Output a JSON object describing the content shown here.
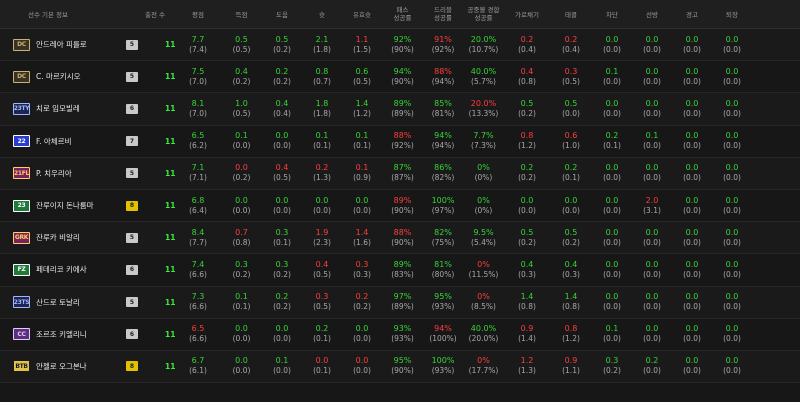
{
  "header": {
    "player_info": "선수 기본 정보",
    "apps": "출전 수",
    "rating": "평점",
    "goals": "득점",
    "assists": "도움",
    "shots": "슛",
    "on_target": "유효슛",
    "pass_success": "패스\n성공률",
    "dribble_success": "드리블\n성공률",
    "aerial_success": "공중볼 경합\n성공률",
    "interceptions": "가로채기",
    "tackles": "태클",
    "blocks": "차단",
    "saves": "선방",
    "yellow": "경고",
    "red": "퇴장"
  },
  "players": [
    {
      "pos": "DC",
      "pos_color": "#c8b27a",
      "pos_bg": "#3b3322",
      "name": "안드레아 피를로",
      "level": "5",
      "gold": false,
      "apps": "11",
      "stats": [
        [
          "7.7",
          "(7.4)",
          "g"
        ],
        [
          "0.5",
          "(0.5)",
          "g"
        ],
        [
          "0.5",
          "(0.2)",
          "g"
        ],
        [
          "2.1",
          "(1.8)",
          "g"
        ],
        [
          "1.1",
          "(1.5)",
          "r"
        ],
        [
          "92%",
          "(90%)",
          "g"
        ],
        [
          "91%",
          "(92%)",
          "r"
        ],
        [
          "20.0%",
          "(10.7%)",
          "g"
        ],
        [
          "0.2",
          "(0.4)",
          "r"
        ],
        [
          "0.2",
          "(0.4)",
          "r"
        ],
        [
          "0.0",
          "(0.0)",
          "g"
        ],
        [
          "0.0",
          "(0.0)",
          "g"
        ],
        [
          "0.0",
          "(0.0)",
          "g"
        ],
        [
          "0.0",
          "(0.0)",
          "g"
        ]
      ]
    },
    {
      "pos": "DC",
      "pos_color": "#c8b27a",
      "pos_bg": "#3b3322",
      "name": "C. 마르키시오",
      "level": "5",
      "gold": false,
      "apps": "11",
      "stats": [
        [
          "7.5",
          "(7.0)",
          "g"
        ],
        [
          "0.4",
          "(0.2)",
          "g"
        ],
        [
          "0.2",
          "(0.2)",
          "g"
        ],
        [
          "0.8",
          "(0.7)",
          "g"
        ],
        [
          "0.6",
          "(0.5)",
          "g"
        ],
        [
          "94%",
          "(90%)",
          "g"
        ],
        [
          "88%",
          "(94%)",
          "r"
        ],
        [
          "40.0%",
          "(5.7%)",
          "g"
        ],
        [
          "0.4",
          "(0.8)",
          "r"
        ],
        [
          "0.3",
          "(0.5)",
          "r"
        ],
        [
          "0.1",
          "(0.0)",
          "g"
        ],
        [
          "0.0",
          "(0.0)",
          "g"
        ],
        [
          "0.0",
          "(0.0)",
          "g"
        ],
        [
          "0.0",
          "(0.0)",
          "g"
        ]
      ]
    },
    {
      "pos": "23TY",
      "pos_color": "#9fb6ff",
      "pos_bg": "#1d2650",
      "name": "치로 임모빌레",
      "level": "6",
      "gold": false,
      "apps": "11",
      "stats": [
        [
          "8.1",
          "(7.0)",
          "g"
        ],
        [
          "1.0",
          "(0.5)",
          "g"
        ],
        [
          "0.4",
          "(0.4)",
          "g"
        ],
        [
          "1.8",
          "(1.8)",
          "g"
        ],
        [
          "1.4",
          "(1.2)",
          "g"
        ],
        [
          "89%",
          "(89%)",
          "g"
        ],
        [
          "85%",
          "(81%)",
          "g"
        ],
        [
          "20.0%",
          "(13.3%)",
          "r"
        ],
        [
          "0.5",
          "(0.2)",
          "g"
        ],
        [
          "0.5",
          "(0.0)",
          "g"
        ],
        [
          "0.0",
          "(0.0)",
          "g"
        ],
        [
          "0.0",
          "(0.0)",
          "g"
        ],
        [
          "0.0",
          "(0.0)",
          "g"
        ],
        [
          "0.0",
          "(0.0)",
          "g"
        ]
      ]
    },
    {
      "pos": "22",
      "pos_color": "#ffffff",
      "pos_bg": "#2a3dd0",
      "name": "F. 아체르비",
      "level": "7",
      "gold": false,
      "apps": "11",
      "stats": [
        [
          "6.5",
          "(6.2)",
          "g"
        ],
        [
          "0.1",
          "(0.0)",
          "g"
        ],
        [
          "0.0",
          "(0.0)",
          "g"
        ],
        [
          "0.1",
          "(0.1)",
          "g"
        ],
        [
          "0.1",
          "(0.1)",
          "g"
        ],
        [
          "88%",
          "(92%)",
          "r"
        ],
        [
          "94%",
          "(94%)",
          "g"
        ],
        [
          "7.7%",
          "(7.3%)",
          "g"
        ],
        [
          "0.8",
          "(1.2)",
          "r"
        ],
        [
          "0.6",
          "(1.0)",
          "r"
        ],
        [
          "0.2",
          "(0.1)",
          "g"
        ],
        [
          "0.1",
          "(0.0)",
          "g"
        ],
        [
          "0.0",
          "(0.0)",
          "g"
        ],
        [
          "0.0",
          "(0.0)",
          "g"
        ]
      ]
    },
    {
      "pos": "21FL",
      "pos_color": "#ffd24a",
      "pos_bg": "#7a1f6e",
      "name": "P. 치우리아",
      "level": "5",
      "gold": false,
      "apps": "11",
      "stats": [
        [
          "7.1",
          "(7.1)",
          "g"
        ],
        [
          "0.0",
          "(0.2)",
          "r"
        ],
        [
          "0.4",
          "(0.5)",
          "r"
        ],
        [
          "0.2",
          "(1.3)",
          "r"
        ],
        [
          "0.1",
          "(0.9)",
          "r"
        ],
        [
          "87%",
          "(87%)",
          "g"
        ],
        [
          "86%",
          "(82%)",
          "g"
        ],
        [
          "0%",
          "(0%)",
          "g"
        ],
        [
          "0.2",
          "(0.2)",
          "g"
        ],
        [
          "0.2",
          "(0.1)",
          "g"
        ],
        [
          "0.0",
          "(0.0)",
          "g"
        ],
        [
          "0.0",
          "(0.0)",
          "g"
        ],
        [
          "0.0",
          "(0.0)",
          "g"
        ],
        [
          "0.0",
          "(0.0)",
          "g"
        ]
      ]
    },
    {
      "pos": "23",
      "pos_color": "#ffffff",
      "pos_bg": "#1c7a3a",
      "name": "잔루이지 돈나룸마",
      "level": "8",
      "gold": true,
      "apps": "11",
      "stats": [
        [
          "6.8",
          "(6.4)",
          "g"
        ],
        [
          "0.0",
          "(0.0)",
          "g"
        ],
        [
          "0.0",
          "(0.0)",
          "g"
        ],
        [
          "0.0",
          "(0.0)",
          "g"
        ],
        [
          "0.0",
          "(0.0)",
          "g"
        ],
        [
          "89%",
          "(90%)",
          "r"
        ],
        [
          "100%",
          "(97%)",
          "g"
        ],
        [
          "0%",
          "(0%)",
          "g"
        ],
        [
          "0.0",
          "(0.0)",
          "g"
        ],
        [
          "0.0",
          "(0.0)",
          "g"
        ],
        [
          "0.0",
          "(0.0)",
          "g"
        ],
        [
          "2.0",
          "(3.1)",
          "r"
        ],
        [
          "0.0",
          "(0.0)",
          "g"
        ],
        [
          "0.0",
          "(0.0)",
          "g"
        ]
      ]
    },
    {
      "pos": "GRK",
      "pos_color": "#ffd24a",
      "pos_bg": "#7a1f6e",
      "name": "잔루카 비알리",
      "level": "5",
      "gold": false,
      "apps": "11",
      "stats": [
        [
          "8.4",
          "(7.7)",
          "g"
        ],
        [
          "0.7",
          "(0.8)",
          "r"
        ],
        [
          "0.3",
          "(0.1)",
          "g"
        ],
        [
          "1.9",
          "(2.3)",
          "r"
        ],
        [
          "1.4",
          "(1.6)",
          "r"
        ],
        [
          "88%",
          "(90%)",
          "r"
        ],
        [
          "82%",
          "(75%)",
          "g"
        ],
        [
          "9.5%",
          "(5.4%)",
          "g"
        ],
        [
          "0.5",
          "(0.2)",
          "g"
        ],
        [
          "0.5",
          "(0.2)",
          "g"
        ],
        [
          "0.0",
          "(0.0)",
          "g"
        ],
        [
          "0.0",
          "(0.0)",
          "g"
        ],
        [
          "0.0",
          "(0.0)",
          "g"
        ],
        [
          "0.0",
          "(0.0)",
          "g"
        ]
      ]
    },
    {
      "pos": "FZ",
      "pos_color": "#ffffff",
      "pos_bg": "#1d7a38",
      "name": "페데리코 키에사",
      "level": "6",
      "gold": false,
      "apps": "11",
      "stats": [
        [
          "7.4",
          "(6.6)",
          "g"
        ],
        [
          "0.3",
          "(0.2)",
          "g"
        ],
        [
          "0.3",
          "(0.2)",
          "g"
        ],
        [
          "0.4",
          "(0.5)",
          "r"
        ],
        [
          "0.3",
          "(0.3)",
          "r"
        ],
        [
          "89%",
          "(83%)",
          "g"
        ],
        [
          "81%",
          "(80%)",
          "g"
        ],
        [
          "0%",
          "(11.5%)",
          "r"
        ],
        [
          "0.4",
          "(0.3)",
          "g"
        ],
        [
          "0.4",
          "(0.3)",
          "g"
        ],
        [
          "0.0",
          "(0.0)",
          "g"
        ],
        [
          "0.0",
          "(0.0)",
          "g"
        ],
        [
          "0.0",
          "(0.0)",
          "g"
        ],
        [
          "0.0",
          "(0.0)",
          "g"
        ]
      ]
    },
    {
      "pos": "23TS",
      "pos_color": "#9fb6ff",
      "pos_bg": "#1d2650",
      "name": "산드로 토날리",
      "level": "5",
      "gold": false,
      "apps": "11",
      "stats": [
        [
          "7.3",
          "(6.6)",
          "g"
        ],
        [
          "0.1",
          "(0.1)",
          "g"
        ],
        [
          "0.2",
          "(0.2)",
          "g"
        ],
        [
          "0.3",
          "(0.5)",
          "r"
        ],
        [
          "0.2",
          "(0.2)",
          "r"
        ],
        [
          "97%",
          "(89%)",
          "g"
        ],
        [
          "95%",
          "(93%)",
          "g"
        ],
        [
          "0%",
          "(8.5%)",
          "r"
        ],
        [
          "1.4",
          "(0.8)",
          "g"
        ],
        [
          "1.4",
          "(0.8)",
          "g"
        ],
        [
          "0.0",
          "(0.0)",
          "g"
        ],
        [
          "0.0",
          "(0.0)",
          "g"
        ],
        [
          "0.0",
          "(0.0)",
          "g"
        ],
        [
          "0.0",
          "(0.0)",
          "g"
        ]
      ]
    },
    {
      "pos": "CC",
      "pos_color": "#e4c9ff",
      "pos_bg": "#5a2f7c",
      "name": "조르조 키엘리니",
      "level": "6",
      "gold": false,
      "apps": "11",
      "stats": [
        [
          "6.5",
          "(6.6)",
          "r"
        ],
        [
          "0.0",
          "(0.0)",
          "g"
        ],
        [
          "0.0",
          "(0.0)",
          "g"
        ],
        [
          "0.2",
          "(0.1)",
          "g"
        ],
        [
          "0.0",
          "(0.0)",
          "g"
        ],
        [
          "93%",
          "(93%)",
          "g"
        ],
        [
          "94%",
          "(100%)",
          "r"
        ],
        [
          "40.0%",
          "(20.0%)",
          "g"
        ],
        [
          "0.9",
          "(1.4)",
          "r"
        ],
        [
          "0.8",
          "(1.2)",
          "r"
        ],
        [
          "0.1",
          "(0.0)",
          "g"
        ],
        [
          "0.0",
          "(0.0)",
          "g"
        ],
        [
          "0.0",
          "(0.0)",
          "g"
        ],
        [
          "0.0",
          "(0.0)",
          "g"
        ]
      ]
    },
    {
      "pos": "BTB",
      "pos_color": "#1a1a1a",
      "pos_bg": "#e0c34a",
      "name": "안젤로 오그본나",
      "level": "8",
      "gold": true,
      "apps": "11",
      "stats": [
        [
          "6.7",
          "(6.1)",
          "g"
        ],
        [
          "0.0",
          "(0.0)",
          "g"
        ],
        [
          "0.1",
          "(0.0)",
          "g"
        ],
        [
          "0.0",
          "(0.1)",
          "r"
        ],
        [
          "0.0",
          "(0.0)",
          "r"
        ],
        [
          "95%",
          "(90%)",
          "g"
        ],
        [
          "100%",
          "(93%)",
          "g"
        ],
        [
          "0%",
          "(17.7%)",
          "r"
        ],
        [
          "1.2",
          "(1.3)",
          "r"
        ],
        [
          "0.9",
          "(1.1)",
          "r"
        ],
        [
          "0.3",
          "(0.2)",
          "g"
        ],
        [
          "0.2",
          "(0.0)",
          "g"
        ],
        [
          "0.0",
          "(0.0)",
          "g"
        ],
        [
          "0.0",
          "(0.0)",
          "g"
        ]
      ]
    }
  ]
}
